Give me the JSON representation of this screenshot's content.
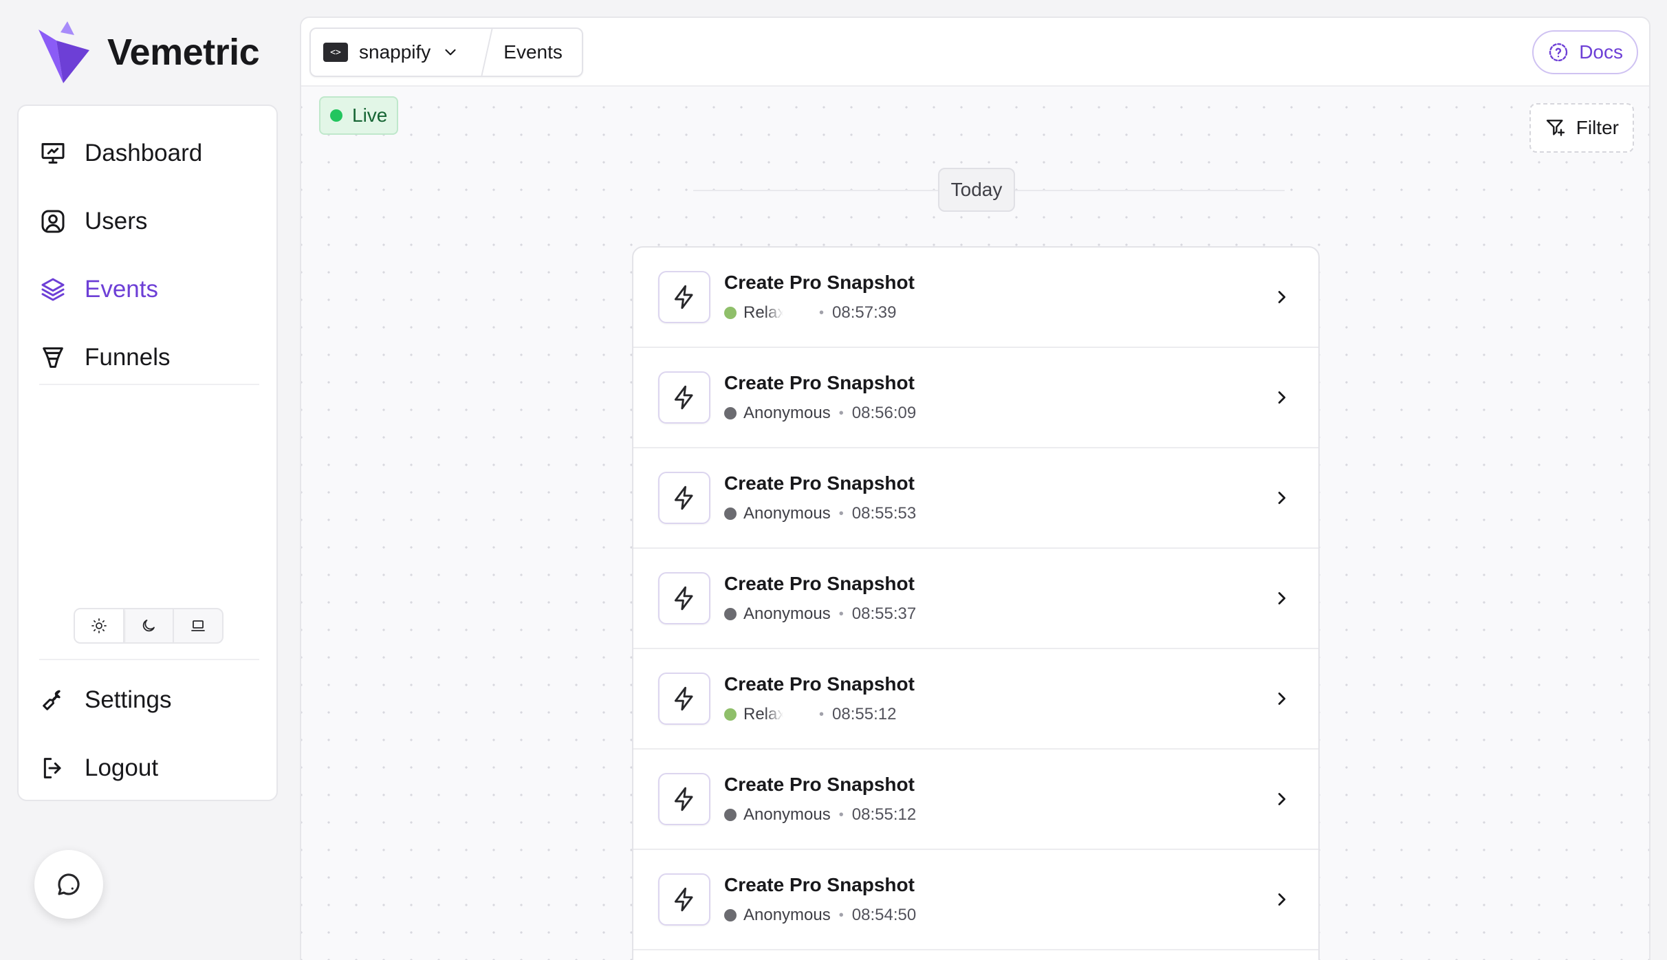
{
  "app": {
    "name": "Vemetric",
    "brand_color": "#6d3fd6"
  },
  "sidebar": {
    "items": [
      {
        "label": "Dashboard",
        "icon": "presentation-chart-icon",
        "active": false
      },
      {
        "label": "Users",
        "icon": "user-circle-icon",
        "active": false
      },
      {
        "label": "Events",
        "icon": "layers-icon",
        "active": true
      },
      {
        "label": "Funnels",
        "icon": "funnel-icon",
        "active": false
      }
    ],
    "bottom_items": [
      {
        "label": "Settings",
        "icon": "wrench-icon"
      },
      {
        "label": "Logout",
        "icon": "logout-icon"
      }
    ],
    "theme_options": [
      "light",
      "dark",
      "system"
    ],
    "theme_selected": "light"
  },
  "header": {
    "project": "snappify",
    "page": "Events",
    "docs_label": "Docs"
  },
  "toolbar": {
    "live_label": "Live",
    "filter_label": "Filter"
  },
  "timeline": {
    "day_label": "Today",
    "events": [
      {
        "name": "Create Pro Snapshot",
        "user": "Relax",
        "user_color": "#8fbf6a",
        "faded": true,
        "time": "08:57:39"
      },
      {
        "name": "Create Pro Snapshot",
        "user": "Anonymous",
        "user_color": "#6b6b70",
        "faded": false,
        "time": "08:56:09"
      },
      {
        "name": "Create Pro Snapshot",
        "user": "Anonymous",
        "user_color": "#6b6b70",
        "faded": false,
        "time": "08:55:53"
      },
      {
        "name": "Create Pro Snapshot",
        "user": "Anonymous",
        "user_color": "#6b6b70",
        "faded": false,
        "time": "08:55:37"
      },
      {
        "name": "Create Pro Snapshot",
        "user": "Relax",
        "user_color": "#8fbf6a",
        "faded": true,
        "time": "08:55:12"
      },
      {
        "name": "Create Pro Snapshot",
        "user": "Anonymous",
        "user_color": "#6b6b70",
        "faded": false,
        "time": "08:55:12"
      },
      {
        "name": "Create Pro Snapshot",
        "user": "Anonymous",
        "user_color": "#6b6b70",
        "faded": false,
        "time": "08:54:50"
      }
    ]
  }
}
